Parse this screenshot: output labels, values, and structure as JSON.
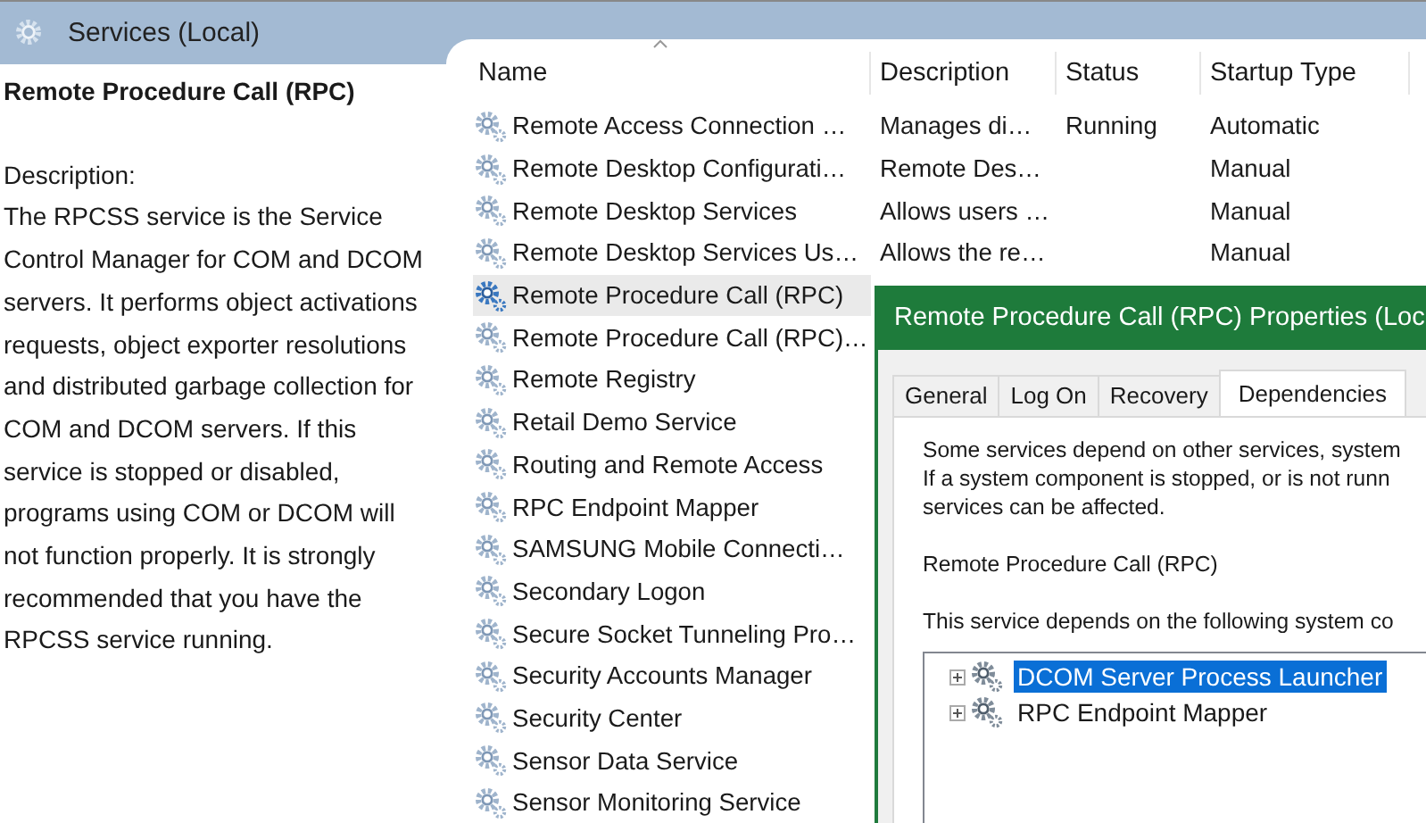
{
  "header": {
    "title": "Services (Local)"
  },
  "detail": {
    "service_name": "Remote Procedure Call (RPC)",
    "description_label": "Description:",
    "description": "The RPCSS service is the Service Control Manager for COM and DCOM servers. It performs object activations requests, object exporter resolutions and distributed garbage collection for COM and DCOM servers. If this service is stopped or disabled, programs using COM or DCOM will not function properly. It is strongly recommended that you have the RPCSS service running."
  },
  "table": {
    "columns": [
      "Name",
      "Description",
      "Status",
      "Startup Type"
    ],
    "rows": [
      {
        "name": "Remote Access Connection …",
        "description": "Manages di…",
        "status": "Running",
        "startup_type": "Automatic",
        "selected": false
      },
      {
        "name": "Remote Desktop Configurati…",
        "description": "Remote Des…",
        "startup_type": "Manual",
        "selected": false
      },
      {
        "name": "Remote Desktop Services",
        "description": "Allows users …",
        "startup_type": "Manual",
        "selected": false
      },
      {
        "name": "Remote Desktop Services Us…",
        "description": "Allows the re…",
        "startup_type": "Manual",
        "selected": false
      },
      {
        "name": "Remote Procedure Call (RPC)",
        "selected": true
      },
      {
        "name": "Remote Procedure Call (RPC)…",
        "selected": false
      },
      {
        "name": "Remote Registry",
        "selected": false
      },
      {
        "name": "Retail Demo Service",
        "selected": false
      },
      {
        "name": "Routing and Remote Access",
        "selected": false
      },
      {
        "name": "RPC Endpoint Mapper",
        "selected": false
      },
      {
        "name": "SAMSUNG Mobile Connecti…",
        "selected": false
      },
      {
        "name": "Secondary Logon",
        "selected": false
      },
      {
        "name": "Secure Socket Tunneling Pro…",
        "selected": false
      },
      {
        "name": "Security Accounts Manager",
        "selected": false
      },
      {
        "name": "Security Center",
        "selected": false
      },
      {
        "name": "Sensor Data Service",
        "selected": false
      },
      {
        "name": "Sensor Monitoring Service",
        "selected": false
      }
    ]
  },
  "dialog": {
    "title": "Remote Procedure Call (RPC) Properties (Loc",
    "tabs": [
      {
        "label": "General",
        "selected": false
      },
      {
        "label": "Log On",
        "selected": false
      },
      {
        "label": "Recovery",
        "selected": false
      },
      {
        "label": "Dependencies",
        "selected": true
      }
    ],
    "intro_lines": [
      "Some services depend on other services, system",
      "If a system component is stopped, or is not runn",
      "services can be affected."
    ],
    "service_name": "Remote Procedure Call (RPC)",
    "depends_label": "This service depends on the following system co",
    "dependencies": [
      {
        "name": "DCOM Server Process Launcher",
        "selected": true,
        "expanded": false
      },
      {
        "name": "RPC Endpoint Mapper",
        "selected": false,
        "expanded": false
      }
    ]
  }
}
